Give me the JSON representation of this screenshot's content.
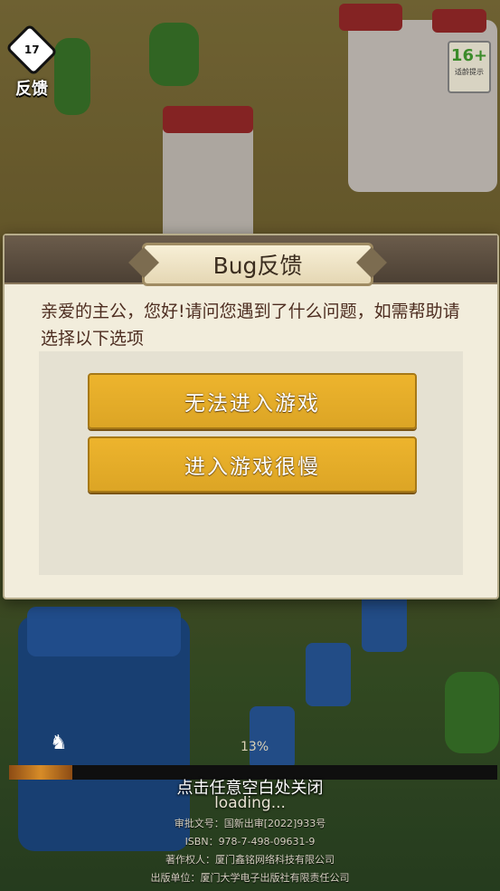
{
  "feedback_button": {
    "label": "反馈"
  },
  "age_badge": {
    "rating": "16+",
    "tip": "适龄提示"
  },
  "dialog": {
    "title": "Bug反馈",
    "message": "亲爱的主公，您好!请问您遇到了什么问题，如需帮助请选择以下选项",
    "options": [
      {
        "label": "无法进入游戏"
      },
      {
        "label": "进入游戏很慢"
      }
    ]
  },
  "loading": {
    "percent_text": "13%",
    "progress": 0.13,
    "text": "loading..."
  },
  "close_tip": "点击任意空白处关闭",
  "info_lines": [
    "审批文号：国新出审[2022]933号",
    "ISBN：978-7-498-09631-9",
    "著作权人：厦门鑫铭网络科技有限公司",
    "出版单位：厦门大学电子出版社有限责任公司"
  ],
  "colors": {
    "button_gold": "#e3ab28",
    "dialog_bg": "#f2eddc",
    "title_text": "#3b2d1f",
    "message_text": "#4d2d20"
  }
}
